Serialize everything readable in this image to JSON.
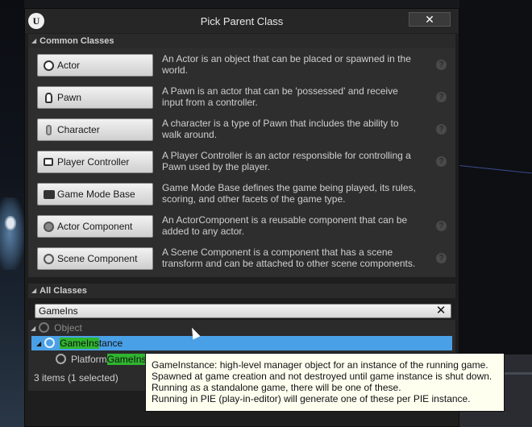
{
  "window": {
    "title": "Pick Parent Class",
    "logo": "U",
    "close": "✕"
  },
  "common": {
    "header": "Common Classes",
    "classes": [
      {
        "label": "Actor",
        "icon": "actor-icon",
        "desc1": "An Actor is an object that can be placed or spawned in the",
        "desc2": "world."
      },
      {
        "label": "Pawn",
        "icon": "pawn-icon",
        "desc1": "A Pawn is an actor that can be 'possessed' and receive",
        "desc2": "input from a controller."
      },
      {
        "label": "Character",
        "icon": "character-icon",
        "desc1": "A character is a type of Pawn that includes the ability to",
        "desc2": "walk around."
      },
      {
        "label": "Player Controller",
        "icon": "player-controller-icon",
        "desc1": "A Player Controller is an actor responsible for controlling a",
        "desc2": "Pawn used by the player."
      },
      {
        "label": "Game Mode Base",
        "icon": "game-mode-icon",
        "desc1": "Game Mode Base defines the game being played, its rules,",
        "desc2": "scoring, and other facets of the game type."
      },
      {
        "label": "Actor Component",
        "icon": "actor-component-icon",
        "desc1": "An ActorComponent is a reusable component that can be",
        "desc2": "added to any actor."
      },
      {
        "label": "Scene Component",
        "icon": "scene-component-icon",
        "desc1": "A Scene Component is a component that has a scene",
        "desc2": "transform and can be attached to other scene components."
      }
    ],
    "help": "?"
  },
  "all": {
    "header": "All Classes",
    "search_value": "GameIns",
    "clear": "✕",
    "tree": {
      "root": "Object",
      "selected_match": "GameIns",
      "selected_rest": "tance",
      "child_prefix": "Platform",
      "child_match": "GameIns"
    },
    "status": "3 items (1 selected)"
  },
  "tooltip": {
    "lines": [
      "GameInstance: high-level manager object for an instance of the running game.",
      "Spawned at game creation and not destroyed until game instance is shut down.",
      "Running as a standalone game, there will be one of these.",
      "Running in PIE (play-in-editor) will generate one of these per PIE instance."
    ]
  },
  "colors": {
    "selection": "#4aa0e6",
    "search_highlight": "#2fb52f",
    "tooltip_bg": "#fffff0"
  }
}
